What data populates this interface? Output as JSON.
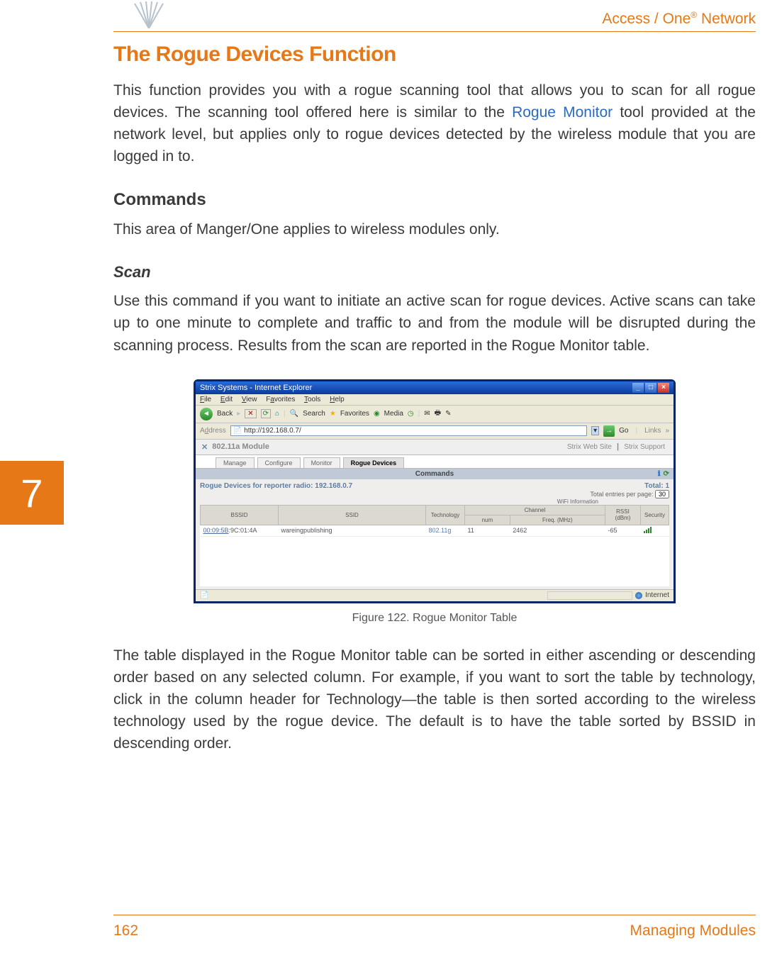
{
  "header": {
    "product": "Access / One",
    "reg": "®",
    "suffix": " Network"
  },
  "chapter_number": "7",
  "title": "The Rogue Devices Function",
  "intro_before_link": "This function provides you with a rogue scanning tool that allows you to scan for all rogue devices. The scanning tool offered here is similar to the ",
  "intro_link": "Rogue Monitor",
  "intro_after_link": " tool provided at the network level, but applies only to rogue devices detected by the wireless module that you are logged in to.",
  "commands_heading": "Commands",
  "commands_body": "This area of Manger/One applies to wireless modules only.",
  "scan_heading": "Scan",
  "scan_body": "Use this command if you want to initiate an active scan for rogue devices. Active scans can take up to one minute to complete and traffic to and from the module will be disrupted during the scanning process. Results from the scan are reported in the Rogue Monitor table.",
  "figure_caption": "Figure 122. Rogue Monitor Table",
  "post_figure_body": "The table displayed in the Rogue Monitor table can be sorted in either ascending or descending order based on any selected column. For example, if you want to sort the table by technology, click in the column header for Technology—the table is then sorted according to the wireless technology used by the rogue device. The default is to have the table sorted by BSSID in descending order.",
  "footer": {
    "page": "162",
    "section": "Managing Modules"
  },
  "screenshot": {
    "window_title": "Strix Systems - Internet Explorer",
    "menu": {
      "file": "File",
      "edit": "Edit",
      "view": "View",
      "favorites": "Favorites",
      "tools": "Tools",
      "help": "Help"
    },
    "toolbar": {
      "back": "Back",
      "search": "Search",
      "favorites": "Favorites",
      "media": "Media"
    },
    "address_label": "Address",
    "url": "http://192.168.0.7/",
    "go": "Go",
    "links": "Links",
    "module_name": "802.11a Module",
    "top_links": {
      "site": "Strix Web Site",
      "support": "Strix Support"
    },
    "tabs": {
      "manage": "Manage",
      "configure": "Configure",
      "monitor": "Monitor",
      "rogue": "Rogue Devices"
    },
    "commands_bar": "Commands",
    "rd_title_prefix": "Rogue Devices for reporter radio: ",
    "rd_title_ip": "192.168.0.7",
    "rd_total_label": "Total: ",
    "rd_total_value": "1",
    "rd_perpage_label": "Total entries per page:",
    "rd_perpage_value": "30",
    "wifi_info_label": "WiFi Information",
    "columns": {
      "bssid": "BSSID",
      "ssid": "SSID",
      "technology": "Technology",
      "channel": "Channel",
      "num": "num",
      "freq": "Freq. (MHz)",
      "rssi": "RSSI (dBm)",
      "security": "Security"
    },
    "row": {
      "bssid_link": "00:09:5B",
      "bssid_rest": ":9C:01:4A",
      "ssid": "wareingpublishing",
      "technology": "802.11g",
      "num": "11",
      "freq": "2462",
      "rssi": "-65"
    },
    "status_internet": "Internet"
  }
}
